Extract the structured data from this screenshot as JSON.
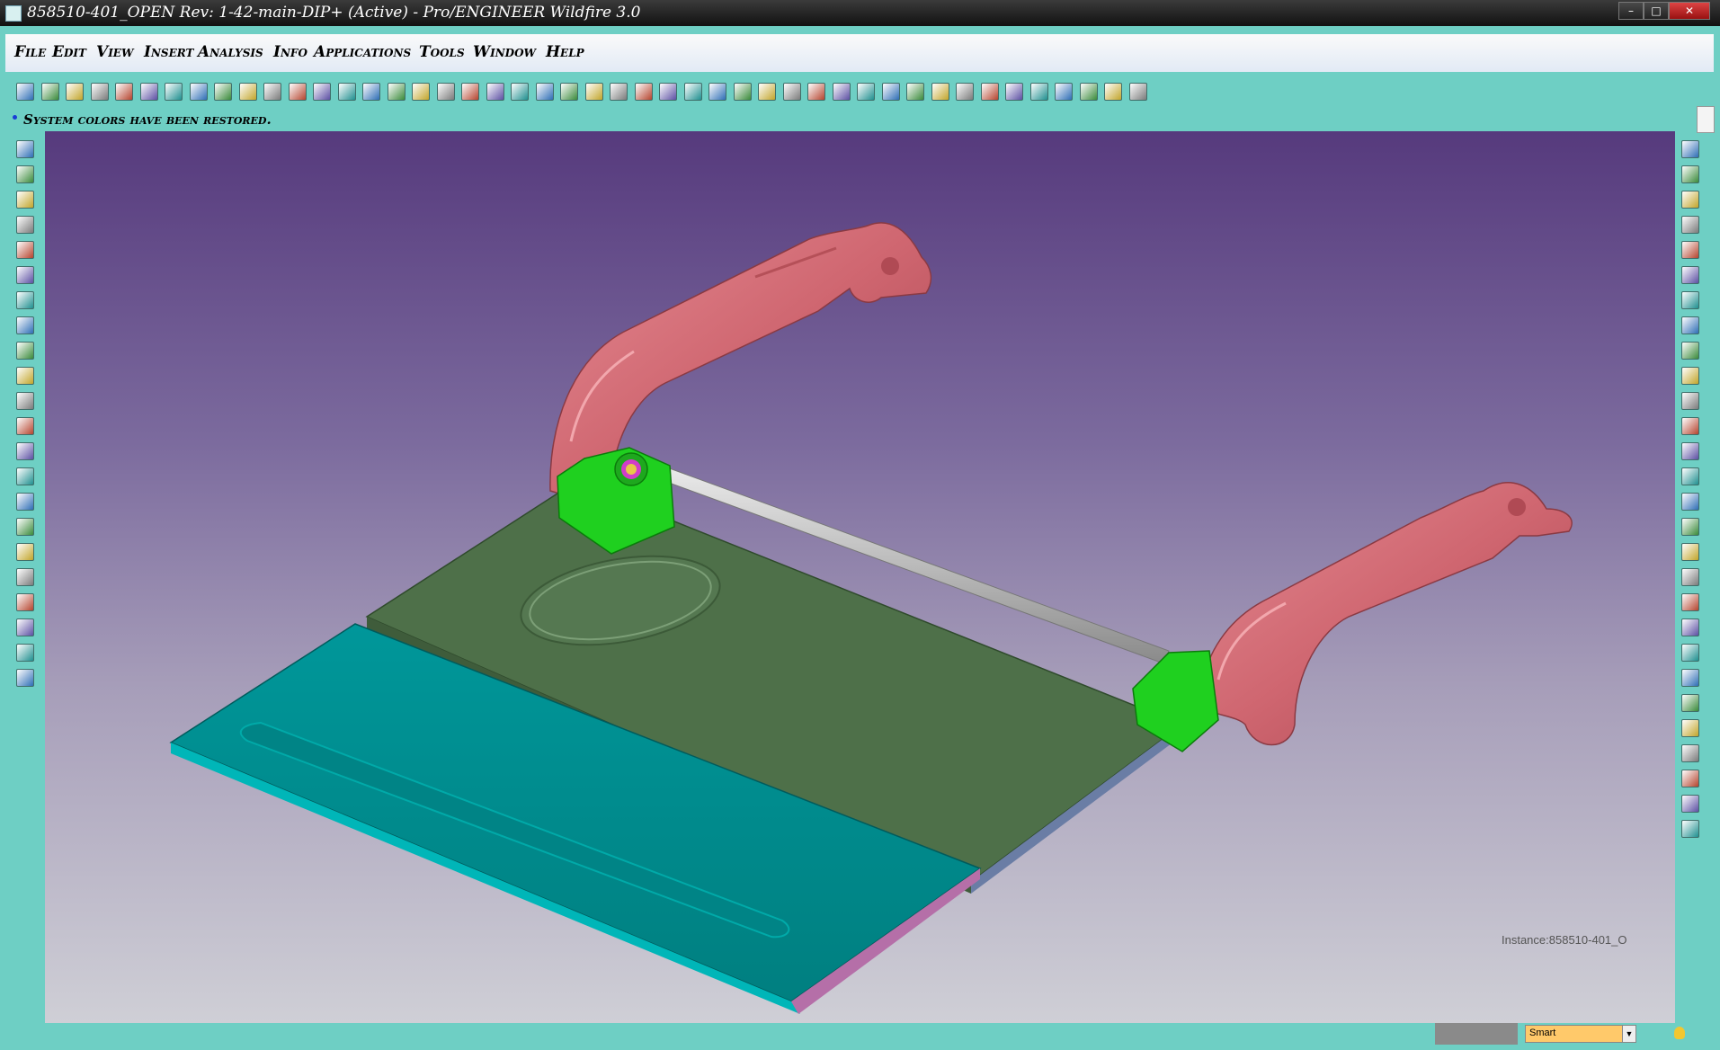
{
  "window": {
    "title": "858510-401_OPEN Rev: 1-42-main-DIP+ (Active) - Pro/ENGINEER Wildfire 3.0",
    "controls": [
      "–",
      "□",
      "✕"
    ]
  },
  "menu": [
    "File",
    "Edit",
    "View",
    "Insert",
    "Analysis",
    "Info",
    "Applications",
    "Tools",
    "Window",
    "Help"
  ],
  "message": "System colors have been restored.",
  "viewport": {
    "instance_label": "Instance:858510-401_O"
  },
  "status": {
    "filter_value": "Smart",
    "filter_arrow": "▼"
  },
  "colors": {
    "chrome": "#6ecfc4",
    "tray": "#4e7049",
    "lid": "#00898a",
    "arms": "#cf6670",
    "hinge": "#1fd01f",
    "bg_top": "#563a7d",
    "bg_bottom": "#cfcfd6"
  },
  "icons": {
    "top_toolbar": [
      "new-window-icon",
      "close-window-icon",
      "model-tree-icon",
      "new-file-icon",
      "open-file-icon",
      "save-icon",
      "save-copy-icon",
      "print-icon",
      "print-preview-icon",
      "export-icon",
      "regenerate-icon",
      "sketch-icon",
      "select-icon",
      "undo-icon",
      "redo-icon",
      "cut-icon",
      "copy-icon",
      "paste-icon",
      "find-icon",
      "select-box-icon",
      "refit-icon",
      "orient-icon",
      "spin-icon",
      "pan-icon",
      "zoom-in-icon",
      "zoom-out-icon",
      "zoom-window-icon",
      "view-manager-icon",
      "named-views-icon",
      "datum-display-icon",
      "axis-icon",
      "layers-icon",
      "appearance-icon",
      "wireframe-icon",
      "hidden-line-icon",
      "no-hidden-icon",
      "shaded-icon",
      "datum-planes-icon",
      "datum-axes-icon",
      "datum-points-icon",
      "coordinate-system-icon",
      "spin-center-icon",
      "annotation-icon",
      "whats-this-icon",
      "window-activate-icon",
      "close-icon"
    ],
    "left_toolbar": [
      "datum-plane-icon",
      "datum-axis-icon",
      "datum-curve-icon",
      "datum-point-icon",
      "extrude-icon",
      "revolve-icon",
      "sweep-icon",
      "blend-icon",
      "hole-icon",
      "round-icon",
      "chamfer-icon",
      "rib-icon",
      "shell-icon",
      "draft-icon",
      "pattern-icon",
      "mirror-icon",
      "merge-icon",
      "trim-icon",
      "offset-icon",
      "thicken-icon",
      "solidify-icon",
      "intersect-icon"
    ],
    "right_toolbar": [
      "find-icon",
      "layers-icon",
      "model-tree-icon",
      "window-activate-icon",
      "open-file-icon",
      "save-icon",
      "edit-icon",
      "print-icon",
      "refit-icon",
      "zoom-in-icon",
      "zoom-out-icon",
      "zoom-window-icon",
      "spin-icon",
      "pan-icon",
      "view-manager-icon",
      "wireframe-icon",
      "hidden-line-icon",
      "no-hidden-icon",
      "shaded-icon",
      "datum-curve-icon",
      "datum-plane-icon",
      "layer-view-icon",
      "sketch-icon",
      "spline-icon",
      "datum-points-icon",
      "coordinate-system-icon",
      "close-icon",
      "annotation-icon"
    ]
  }
}
